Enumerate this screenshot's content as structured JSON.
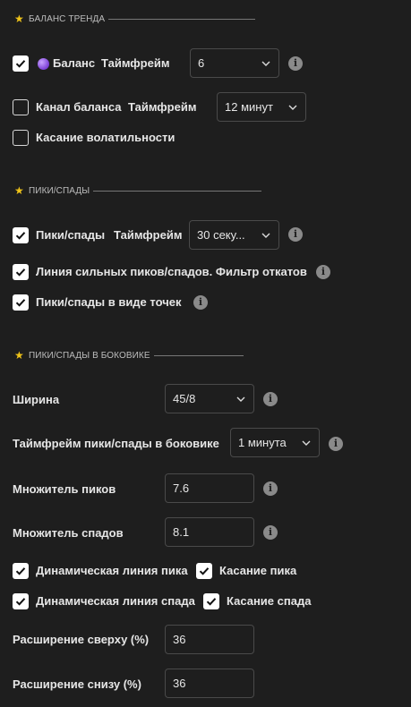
{
  "sections": {
    "balance_trend": "БАЛАНС ТРЕНДА",
    "peaks": "ПИКИ/СПАДЫ",
    "sideways": "ПИКИ/СПАДЫ В БОКОВИКЕ"
  },
  "balance": {
    "label": "Баланс",
    "checked": true,
    "tf_label": "Таймфрейм",
    "tf_value": "6"
  },
  "channel": {
    "label": "Канал баланса",
    "checked": false,
    "tf_label": "Таймфрейм",
    "tf_value": "12 минут"
  },
  "volatility": {
    "label": "Касание волатильности",
    "checked": false
  },
  "peaks": {
    "label": "Пики/спады",
    "checked": true,
    "tf_label": "Таймфрейм",
    "tf_value": "30 секу..."
  },
  "strong_line": {
    "label": "Линия сильных пиков/спадов. Фильтр откатов",
    "checked": true
  },
  "dots": {
    "label": "Пики/спады в виде точек",
    "checked": true
  },
  "width": {
    "label": "Ширина",
    "value": "45/8"
  },
  "side_tf": {
    "label": "Таймфрейм пики/спады в боковике",
    "value": "1 минута"
  },
  "peak_mult": {
    "label": "Множитель пиков",
    "value": "7.6"
  },
  "trough_mult": {
    "label": "Множитель спадов",
    "value": "8.1"
  },
  "dyn_peak": {
    "label": "Динамическая линия пика",
    "checked": true
  },
  "touch_peak": {
    "label": "Касание пика",
    "checked": true
  },
  "dyn_trough": {
    "label": "Динамическая линия спада",
    "checked": true
  },
  "touch_trough": {
    "label": "Касание спада",
    "checked": true
  },
  "ext_top": {
    "label": "Расширение сверху (%)",
    "value": "36"
  },
  "ext_bottom": {
    "label": "Расширение снизу (%)",
    "value": "36"
  },
  "icons": {
    "section": "star-icon",
    "info": "info-icon",
    "dropdown": "chevron-down-icon",
    "check": "checkmark-icon"
  },
  "colors": {
    "background": "#1e1e1e",
    "star": "#f0c419",
    "balance_dot": "#8e4fe6"
  }
}
